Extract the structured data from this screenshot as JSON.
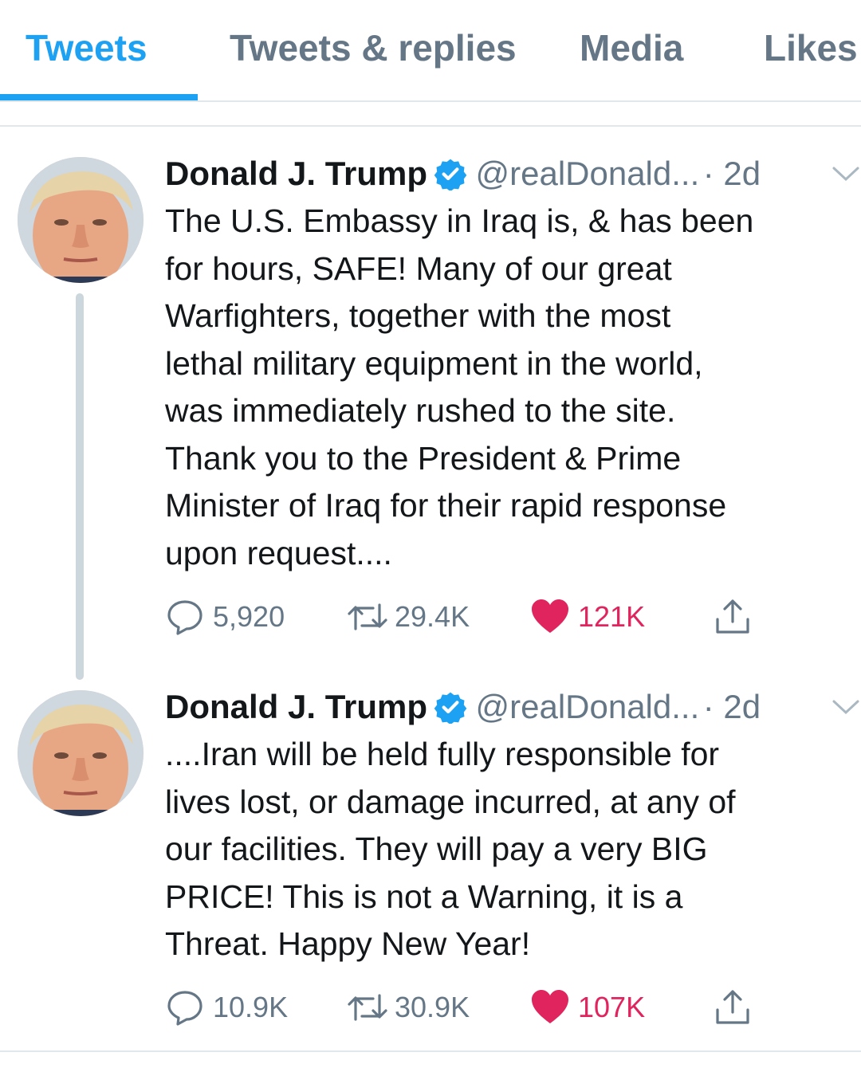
{
  "tabs": [
    {
      "label": "Tweets",
      "active": true
    },
    {
      "label": "Tweets & replies",
      "active": false
    },
    {
      "label": "Media",
      "active": false
    },
    {
      "label": "Likes",
      "active": false
    }
  ],
  "colors": {
    "accent": "#1da1f2",
    "like": "#e0245e",
    "secondary_text": "#657786",
    "divider": "#e1e8ed"
  },
  "tweets": [
    {
      "author_name": "Donald J. Trump",
      "verified": true,
      "handle": "@realDonald...",
      "time": "· 2d",
      "text": "The U.S. Embassy in Iraq is, & has been\nfor hours, SAFE! Many of our great\nWarfighters, together with the most\nlethal military equipment in the world,\nwas immediately rushed to the site.\nThank you to the President & Prime\nMinister of Iraq for their rapid response\nupon request....",
      "replies": "5,920",
      "retweets": "29.4K",
      "likes": "121K",
      "liked": true
    },
    {
      "author_name": "Donald J. Trump",
      "verified": true,
      "handle": "@realDonald...",
      "time": "· 2d",
      "text": "....Iran will be held fully responsible for\nlives lost, or damage incurred, at any of\nour facilities. They will pay a very BIG\nPRICE! This is not a Warning, it is a\nThreat. Happy New Year!",
      "replies": "10.9K",
      "retweets": "30.9K",
      "likes": "107K",
      "liked": true
    }
  ],
  "icons": [
    "verified-badge-icon",
    "chevron-down-icon",
    "reply-icon",
    "retweet-icon",
    "heart-icon",
    "share-icon"
  ]
}
